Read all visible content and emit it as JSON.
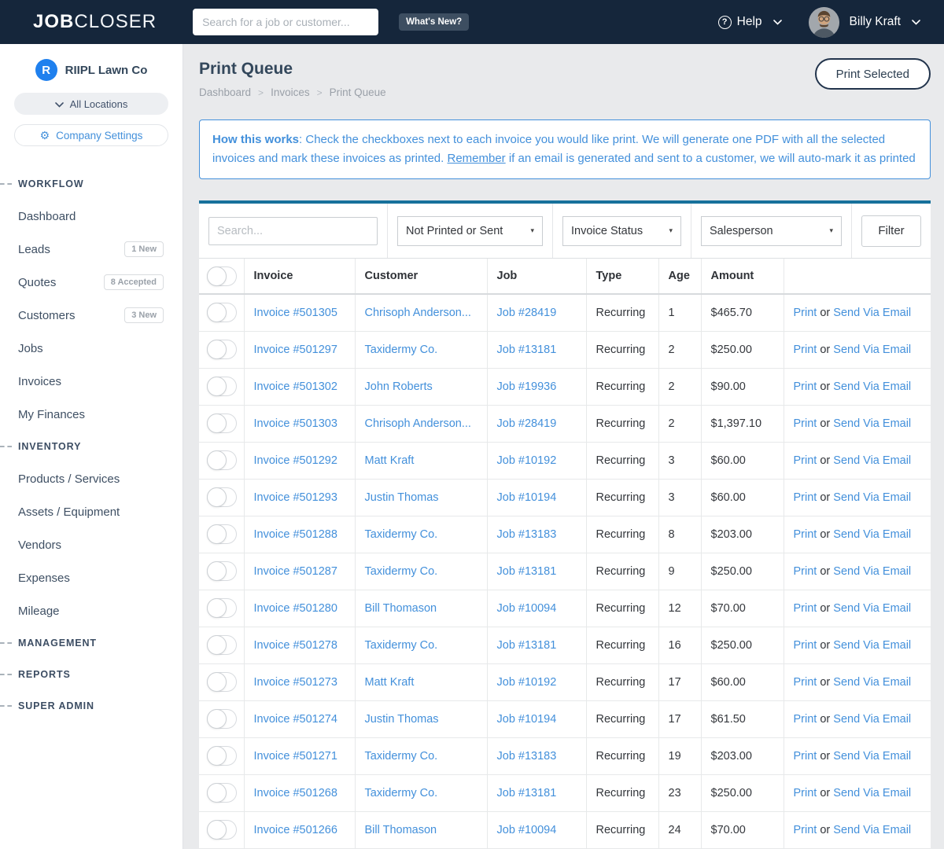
{
  "colors": {
    "header_bg": "#15263b",
    "accent_blue": "#4390db",
    "card_top_border": "#17719b",
    "dark_navy": "#33475b",
    "company_logo_blue": "#1f80ee"
  },
  "header": {
    "logo_bold": "JOB",
    "logo_light": "CLOSER",
    "search_placeholder": "Search for a job or customer...",
    "whats_new_label": "What's New?",
    "help_label": "Help",
    "help_icon": "?",
    "user_name": "Billy Kraft"
  },
  "sidebar": {
    "company": {
      "initial": "R",
      "name": "RIIPL Lawn Co"
    },
    "location_selector_label": "All Locations",
    "company_settings_label": "Company Settings",
    "sections": [
      {
        "heading": "WORKFLOW",
        "items": [
          {
            "label": "Dashboard"
          },
          {
            "label": "Leads",
            "badge": "1 New"
          },
          {
            "label": "Quotes",
            "badge": "8 Accepted"
          },
          {
            "label": "Customers",
            "badge": "3 New"
          },
          {
            "label": "Jobs"
          },
          {
            "label": "Invoices"
          },
          {
            "label": "My Finances"
          }
        ]
      },
      {
        "heading": "INVENTORY",
        "items": [
          {
            "label": "Products / Services"
          },
          {
            "label": "Assets / Equipment"
          },
          {
            "label": "Vendors"
          },
          {
            "label": "Expenses"
          },
          {
            "label": "Mileage"
          }
        ]
      },
      {
        "heading": "MANAGEMENT",
        "items": []
      },
      {
        "heading": "REPORTS",
        "items": []
      },
      {
        "heading": "SUPER ADMIN",
        "items": []
      }
    ]
  },
  "page": {
    "title": "Print Queue",
    "breadcrumb": [
      "Dashboard",
      "Invoices",
      "Print Queue"
    ],
    "print_selected_label": "Print Selected",
    "info": {
      "bold": "How this works",
      "text_after_bold": ": Check the checkboxes next to each invoice you would like print. We will generate one PDF with all the selected invoices and mark these invoices as printed. ",
      "underlined": "Remember",
      "text_end": " if an email is generated and sent to a customer, we will auto-mark it as printed"
    }
  },
  "filters": {
    "search_placeholder": "Search...",
    "dropdowns": [
      "Not Printed or Sent",
      "Invoice Status",
      "Salesperson"
    ],
    "caret": "▾",
    "filter_button_label": "Filter"
  },
  "table": {
    "headers": [
      "Invoice",
      "Customer",
      "Job",
      "Type",
      "Age",
      "Amount"
    ],
    "action_labels": {
      "print": "Print",
      "or": "or",
      "email": "Send Via Email"
    },
    "rows": [
      {
        "invoice": "Invoice #501305",
        "customer": "Chrisoph Anderson...",
        "job": "Job #28419",
        "type": "Recurring",
        "age": "1",
        "amount": "$465.70"
      },
      {
        "invoice": "Invoice #501297",
        "customer": "Taxidermy Co.",
        "job": "Job #13181",
        "type": "Recurring",
        "age": "2",
        "amount": "$250.00"
      },
      {
        "invoice": "Invoice #501302",
        "customer": "John Roberts",
        "job": "Job #19936",
        "type": "Recurring",
        "age": "2",
        "amount": "$90.00"
      },
      {
        "invoice": "Invoice #501303",
        "customer": "Chrisoph Anderson...",
        "job": "Job #28419",
        "type": "Recurring",
        "age": "2",
        "amount": "$1,397.10"
      },
      {
        "invoice": "Invoice #501292",
        "customer": "Matt Kraft",
        "job": "Job #10192",
        "type": "Recurring",
        "age": "3",
        "amount": "$60.00"
      },
      {
        "invoice": "Invoice #501293",
        "customer": "Justin Thomas",
        "job": "Job #10194",
        "type": "Recurring",
        "age": "3",
        "amount": "$60.00"
      },
      {
        "invoice": "Invoice #501288",
        "customer": "Taxidermy Co.",
        "job": "Job #13183",
        "type": "Recurring",
        "age": "8",
        "amount": "$203.00"
      },
      {
        "invoice": "Invoice #501287",
        "customer": "Taxidermy Co.",
        "job": "Job #13181",
        "type": "Recurring",
        "age": "9",
        "amount": "$250.00"
      },
      {
        "invoice": "Invoice #501280",
        "customer": "Bill Thomason",
        "job": "Job #10094",
        "type": "Recurring",
        "age": "12",
        "amount": "$70.00"
      },
      {
        "invoice": "Invoice #501278",
        "customer": "Taxidermy Co.",
        "job": "Job #13181",
        "type": "Recurring",
        "age": "16",
        "amount": "$250.00"
      },
      {
        "invoice": "Invoice #501273",
        "customer": "Matt Kraft",
        "job": "Job #10192",
        "type": "Recurring",
        "age": "17",
        "amount": "$60.00"
      },
      {
        "invoice": "Invoice #501274",
        "customer": "Justin Thomas",
        "job": "Job #10194",
        "type": "Recurring",
        "age": "17",
        "amount": "$61.50"
      },
      {
        "invoice": "Invoice #501271",
        "customer": "Taxidermy Co.",
        "job": "Job #13183",
        "type": "Recurring",
        "age": "19",
        "amount": "$203.00"
      },
      {
        "invoice": "Invoice #501268",
        "customer": "Taxidermy Co.",
        "job": "Job #13181",
        "type": "Recurring",
        "age": "23",
        "amount": "$250.00"
      },
      {
        "invoice": "Invoice #501266",
        "customer": "Bill Thomason",
        "job": "Job #10094",
        "type": "Recurring",
        "age": "24",
        "amount": "$70.00"
      }
    ]
  }
}
